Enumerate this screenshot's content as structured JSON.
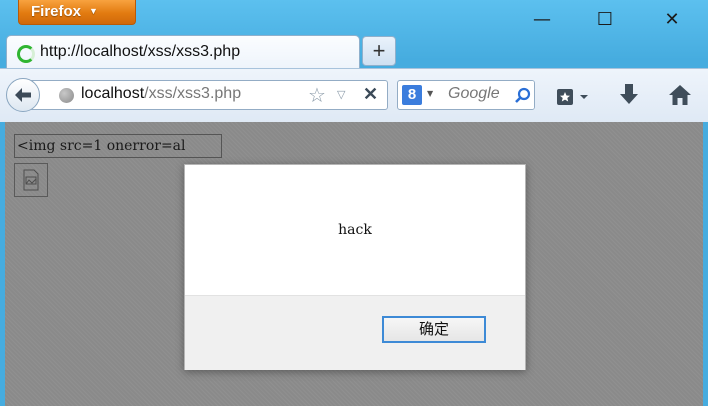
{
  "app": {
    "menu_label": "Firefox",
    "menu_caret": "▼"
  },
  "window_controls": {
    "minimize": "—",
    "maximize": "☐",
    "close": "✕"
  },
  "tab": {
    "title": "http://localhost/xss/xss3.php",
    "status": "loading"
  },
  "new_tab": {
    "label": "+"
  },
  "urlbar": {
    "host": "localhost",
    "path": "/xss/xss3.php"
  },
  "searchbar": {
    "engine_letter": "8",
    "placeholder": "Google"
  },
  "icons": {
    "back": "back-arrow-icon",
    "site": "globe-icon",
    "bookmark_star": "star-icon",
    "stop": "stop-icon",
    "search": "magnifier-icon",
    "bookmarks": "bookmarks-menu-icon",
    "downloads": "download-icon",
    "home": "home-icon",
    "broken_image": "broken-image-icon"
  },
  "page": {
    "input_value": "<img src=1 onerror=al"
  },
  "dialog": {
    "message": "hack",
    "ok_label": "确定"
  },
  "colors": {
    "frame": "#46acdf",
    "firefox_button": "#e27b10",
    "overlay": "#8a8a8a",
    "focus_border": "#3d8ad6"
  }
}
